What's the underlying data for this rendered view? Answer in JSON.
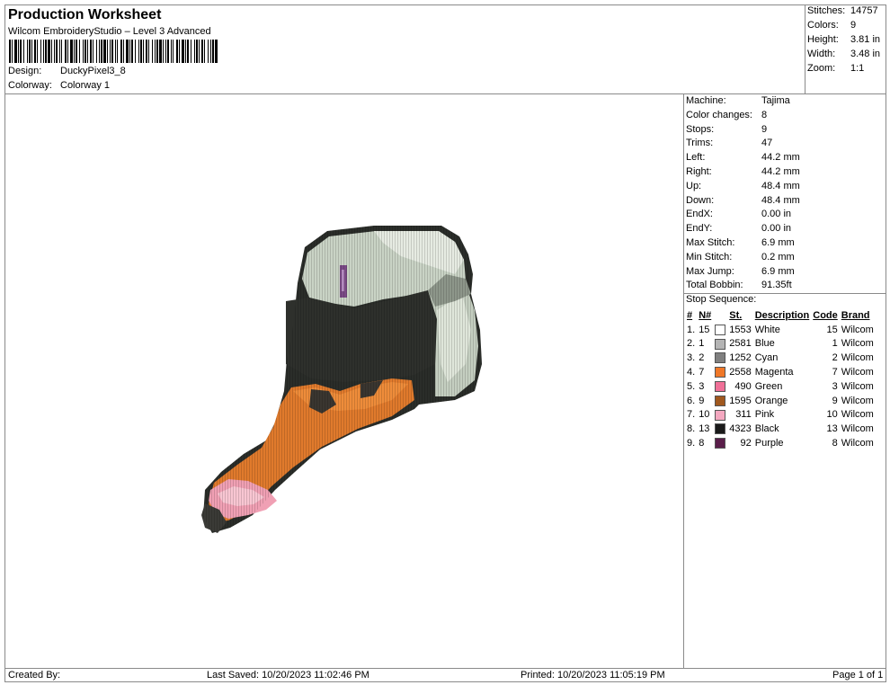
{
  "header": {
    "title": "Production Worksheet",
    "subtitle": "Wilcom EmbroideryStudio – Level 3 Advanced",
    "design_label": "Design:",
    "design_value": "DuckyPixel3_8",
    "colorway_label": "Colorway:",
    "colorway_value": "Colorway 1"
  },
  "stats": [
    {
      "label": "Stitches:",
      "value": "14757"
    },
    {
      "label": "Colors:",
      "value": "9"
    },
    {
      "label": "Height:",
      "value": "3.81 in"
    },
    {
      "label": "Width:",
      "value": "3.48 in"
    },
    {
      "label": "Zoom:",
      "value": "1:1"
    }
  ],
  "machine_info": [
    {
      "label": "Machine:",
      "value": "Tajima"
    },
    {
      "label": "Color changes:",
      "value": "8"
    },
    {
      "label": "Stops:",
      "value": "9"
    },
    {
      "label": "Trims:",
      "value": "47"
    },
    {
      "label": "Left:",
      "value": "44.2 mm"
    },
    {
      "label": "Right:",
      "value": "44.2 mm"
    },
    {
      "label": "Up:",
      "value": "48.4 mm"
    },
    {
      "label": "Down:",
      "value": "48.4 mm"
    },
    {
      "label": "EndX:",
      "value": "0.00 in"
    },
    {
      "label": "EndY:",
      "value": "0.00 in"
    },
    {
      "label": "Max Stitch:",
      "value": "6.9 mm"
    },
    {
      "label": "Min Stitch:",
      "value": "0.2 mm"
    },
    {
      "label": "Max Jump:",
      "value": "6.9 mm"
    },
    {
      "label": "Total Bobbin:",
      "value": "91.35ft"
    }
  ],
  "stop_sequence": {
    "title": "Stop Sequence:",
    "headers": {
      "num": "#",
      "n": "N#",
      "st": "St.",
      "description": "Description",
      "code": "Code",
      "brand": "Brand"
    },
    "rows": [
      {
        "num": "1.",
        "n": "15",
        "color": "#ffffff",
        "st": "1553",
        "description": "White",
        "code": "15",
        "brand": "Wilcom"
      },
      {
        "num": "2.",
        "n": "1",
        "color": "#b4b4b4",
        "st": "2581",
        "description": "Blue",
        "code": "1",
        "brand": "Wilcom"
      },
      {
        "num": "3.",
        "n": "2",
        "color": "#808080",
        "st": "1252",
        "description": "Cyan",
        "code": "2",
        "brand": "Wilcom"
      },
      {
        "num": "4.",
        "n": "7",
        "color": "#f07828",
        "st": "2558",
        "description": "Magenta",
        "code": "7",
        "brand": "Wilcom"
      },
      {
        "num": "5.",
        "n": "3",
        "color": "#f07098",
        "st": "490",
        "description": "Green",
        "code": "3",
        "brand": "Wilcom"
      },
      {
        "num": "6.",
        "n": "9",
        "color": "#a0581e",
        "st": "1595",
        "description": "Orange",
        "code": "9",
        "brand": "Wilcom"
      },
      {
        "num": "7.",
        "n": "10",
        "color": "#f4a8c0",
        "st": "311",
        "description": "Pink",
        "code": "10",
        "brand": "Wilcom"
      },
      {
        "num": "8.",
        "n": "13",
        "color": "#1a1a1a",
        "st": "4323",
        "description": "Black",
        "code": "13",
        "brand": "Wilcom"
      },
      {
        "num": "9.",
        "n": "8",
        "color": "#5a1e4a",
        "st": "92",
        "description": "Purple",
        "code": "8",
        "brand": "Wilcom"
      }
    ]
  },
  "footer": {
    "created_by": "Created By:",
    "last_saved": "Last Saved: 10/20/2023 11:02:46 PM",
    "printed": "Printed: 10/20/2023 11:05:19 PM",
    "page": "Page 1 of 1"
  }
}
